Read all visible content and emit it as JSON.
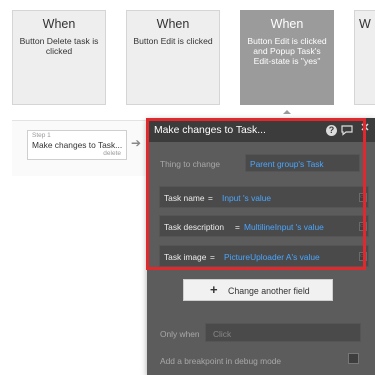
{
  "workflow_cards": [
    {
      "title": "When",
      "description": "Button Delete task is clicked"
    },
    {
      "title": "When",
      "description": "Button Edit is clicked"
    },
    {
      "title": "When",
      "description": "Button Edit is clicked and Popup Task's Edit-state is \"yes\""
    },
    {
      "title": "W"
    }
  ],
  "step": {
    "number": "Step 1",
    "label": "Make changes to Task...",
    "delete_label": "delete"
  },
  "panel": {
    "title": "Make changes to Task...",
    "thing_label": "Thing to change",
    "thing_value": "Parent group's Task",
    "fields": [
      {
        "label": "Task name",
        "op": "=",
        "value": "Input 's value"
      },
      {
        "label": "Task description",
        "op": "=",
        "value": "MultilineInput 's value"
      },
      {
        "label": "Task image",
        "op": "=",
        "value": "PictureUploader A's value"
      }
    ],
    "change_another_label": "Change another field",
    "only_when_label": "Only when",
    "only_when_placeholder": "Click",
    "breakpoint_label": "Add a breakpoint in debug mode"
  },
  "colors": {
    "highlight": "#e0282d",
    "expression": "#4aa6ff",
    "panel_bg": "#5c5c5c"
  },
  "icons": [
    "help-icon",
    "comment-icon",
    "close-icon",
    "plus-icon",
    "arrow-right-icon"
  ]
}
